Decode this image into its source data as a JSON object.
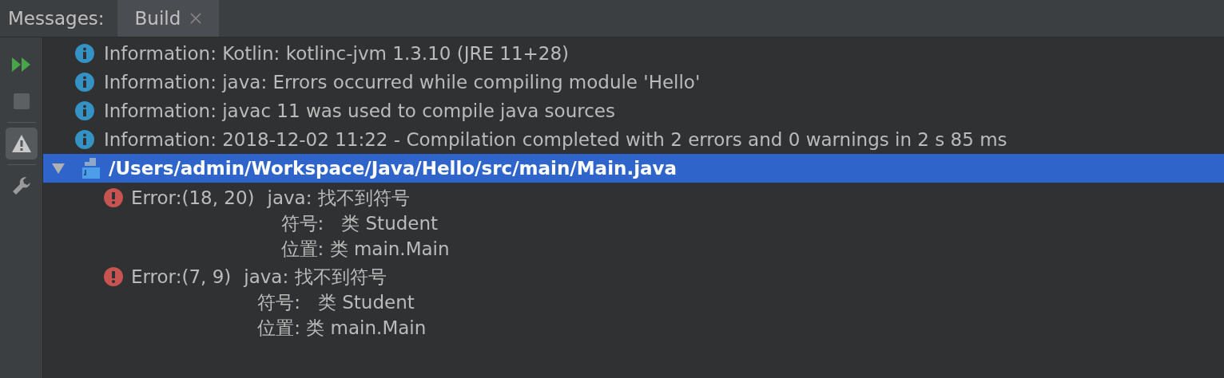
{
  "tab_strip": {
    "label": "Messages:",
    "tabs": [
      {
        "label": "Build",
        "selected": true,
        "closable": true
      }
    ]
  },
  "toolbar": [
    {
      "kind": "rerun",
      "selected": false
    },
    {
      "kind": "stop",
      "selected": false
    },
    {
      "kind": "warnings",
      "selected": true
    },
    {
      "kind": "settings",
      "selected": false
    }
  ],
  "messages": [
    {
      "kind": "info",
      "text": "Information: Kotlin: kotlinc-jvm 1.3.10 (JRE 11+28)"
    },
    {
      "kind": "info",
      "text": "Information: java: Errors occurred while compiling module 'Hello'"
    },
    {
      "kind": "info",
      "text": "Information: javac 11 was used to compile java sources"
    },
    {
      "kind": "info",
      "text": "Information: 2018-12-02 11:22 - Compilation completed with 2 errors and 0 warnings in 2 s 85 ms"
    },
    {
      "kind": "file",
      "path": "/Users/admin/Workspace/Java/Hello/src/main/Main.java",
      "expanded": true,
      "selected": true,
      "children": [
        {
          "kind": "error",
          "location": "Error:(18, 20)",
          "lines": [
            "java: 找不到符号",
            "符号:   类 Student",
            "位置: 类 main.Main"
          ]
        },
        {
          "kind": "error",
          "location": "Error:(7, 9)",
          "lines": [
            "java: 找不到符号",
            "符号:   类 Student",
            "位置: 类 main.Main"
          ]
        }
      ]
    }
  ]
}
